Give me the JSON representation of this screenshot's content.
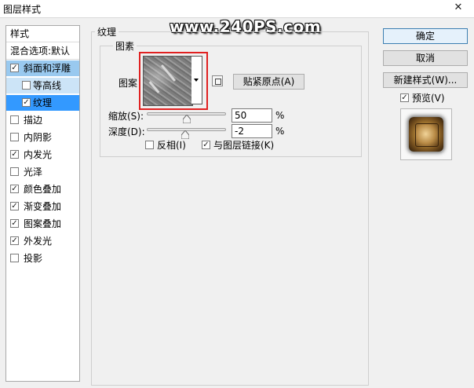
{
  "window": {
    "title": "图层样式",
    "close_glyph": "✕"
  },
  "watermark": "www.240PS.com",
  "sidebar": {
    "header": "样式",
    "blend_options": "混合选项:默认",
    "items": [
      {
        "label": "斜面和浮雕",
        "checked": true,
        "state": "selected-parent"
      },
      {
        "label": "等高线",
        "checked": false,
        "state": "sub"
      },
      {
        "label": "纹理",
        "checked": true,
        "state": "selected"
      },
      {
        "label": "描边",
        "checked": false
      },
      {
        "label": "内阴影",
        "checked": false
      },
      {
        "label": "内发光",
        "checked": true
      },
      {
        "label": "光泽",
        "checked": false
      },
      {
        "label": "颜色叠加",
        "checked": true
      },
      {
        "label": "渐变叠加",
        "checked": true
      },
      {
        "label": "图案叠加",
        "checked": true
      },
      {
        "label": "外发光",
        "checked": true
      },
      {
        "label": "投影",
        "checked": false
      }
    ]
  },
  "texture": {
    "group_title": "纹理",
    "sub_group_title": "图素",
    "pattern_label": "图案",
    "snap_button": "贴紧原点(A)",
    "scale": {
      "label": "缩放(S):",
      "value": "50",
      "unit": "%",
      "level_percent": 50
    },
    "depth": {
      "label": "深度(D):",
      "value": "-2",
      "unit": "%",
      "level_percent": 49
    },
    "invert": {
      "label": "反相(I)",
      "checked": false
    },
    "link": {
      "label": "与图层链接(K)",
      "checked": true
    }
  },
  "buttons": {
    "ok": "确定",
    "cancel": "取消",
    "new_style": "新建样式(W)...",
    "preview": {
      "label": "预览(V)",
      "checked": true
    }
  },
  "colors": {
    "selection": "#3399ff",
    "highlight_border": "#e02020"
  },
  "icons": {
    "check": "✓",
    "close": "close-icon",
    "new_pattern": "new-preset-icon",
    "dropdown": "triangle-down-icon"
  }
}
